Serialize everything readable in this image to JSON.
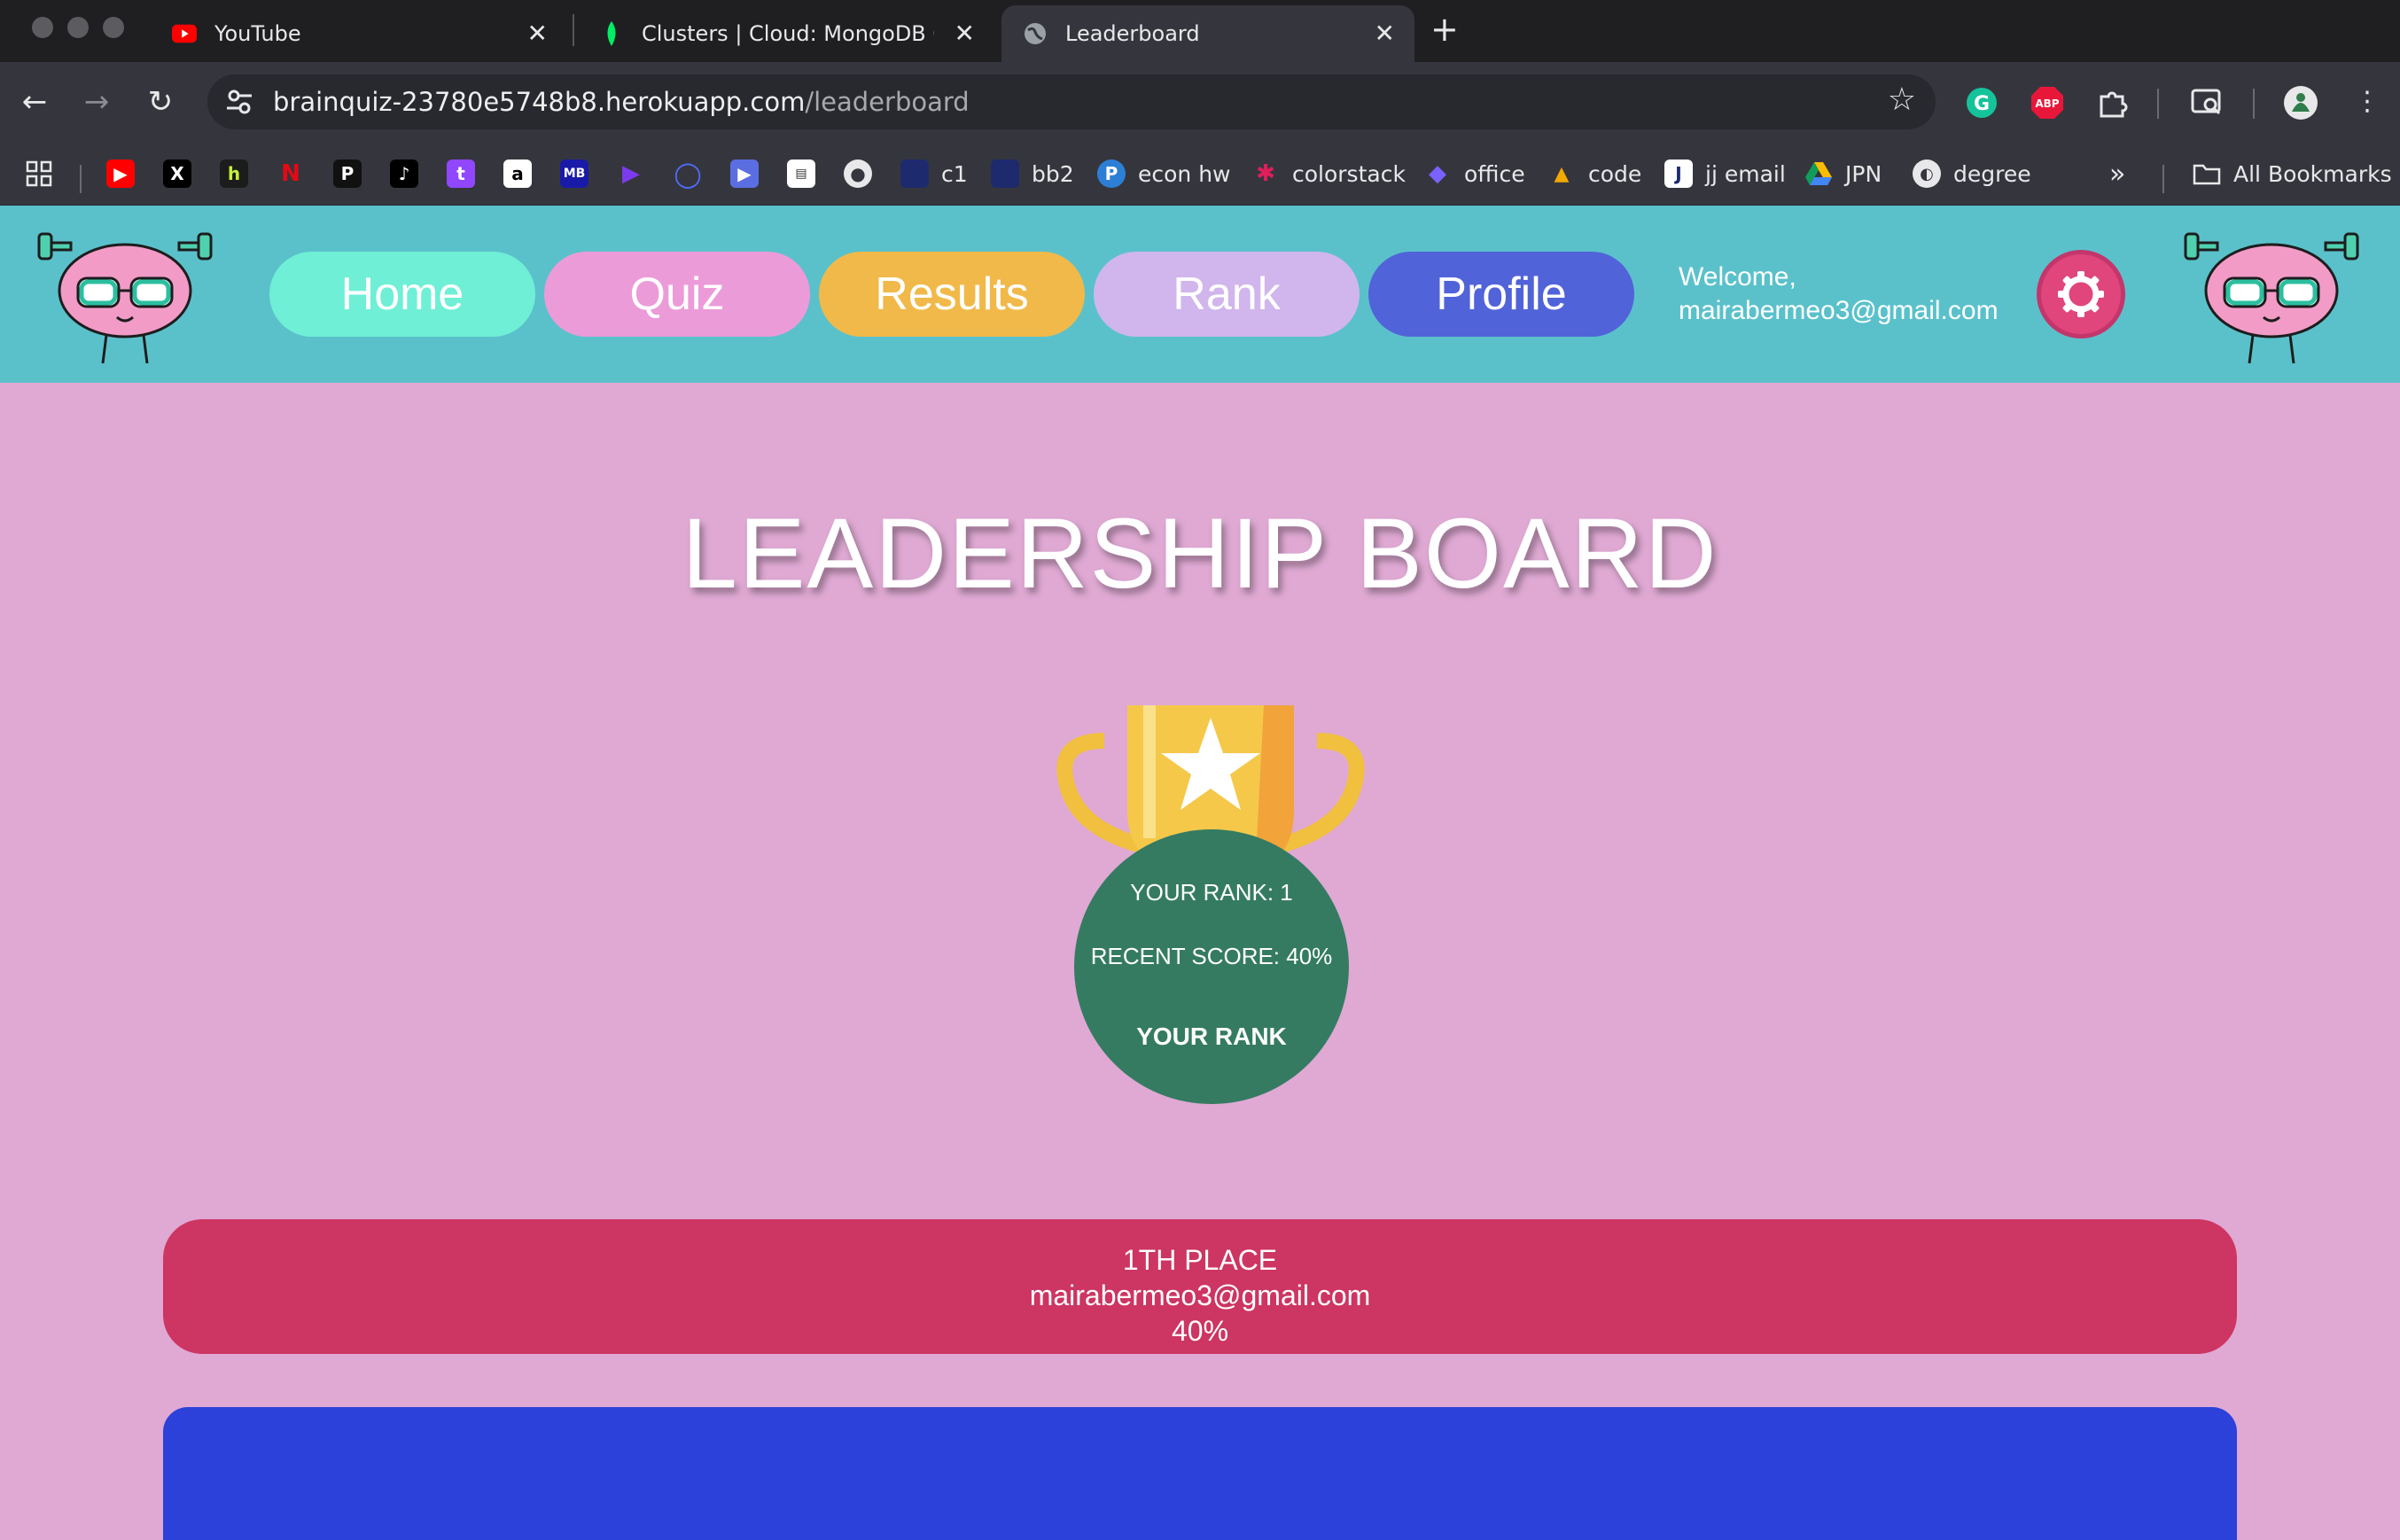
{
  "browser": {
    "tabs": [
      {
        "title": "YouTube",
        "icon": "youtube-icon",
        "active": false
      },
      {
        "title": "Clusters | Cloud: MongoDB Cl",
        "icon": "mongodb-leaf-icon",
        "active": false
      },
      {
        "title": "Leaderboard",
        "icon": "globe-icon",
        "active": true
      }
    ],
    "url_host": "brainquiz-23780e5748b8.herokuapp.com",
    "url_path": "/leaderboard",
    "bookmarks": [
      {
        "label": "c1"
      },
      {
        "label": "bb2"
      },
      {
        "label": "econ hw"
      },
      {
        "label": "colorstack"
      },
      {
        "label": "office"
      },
      {
        "label": "code"
      },
      {
        "label": "jj email"
      },
      {
        "label": "JPN"
      },
      {
        "label": "degree"
      }
    ],
    "all_bookmarks": "All Bookmarks"
  },
  "nav": {
    "home": "Home",
    "quiz": "Quiz",
    "results": "Results",
    "rank": "Rank",
    "profile": "Profile",
    "welcome_line1": "Welcome,",
    "welcome_line2": "mairabermeo3@gmail.com"
  },
  "leaderboard": {
    "title": "LEADERSHIP BOARD",
    "your_rank": "YOUR RANK: 1",
    "recent_score": "RECENT SCORE: 40%",
    "your_rank_button": "YOUR RANK",
    "entries": [
      {
        "place": "1TH PLACE",
        "email": "mairabermeo3@gmail.com",
        "score": "40%"
      }
    ]
  },
  "colors": {
    "page_bg": "#dfa9d3",
    "header_bg": "#5ac1cb",
    "home": "#6fefd6",
    "quiz": "#ec9bd9",
    "results": "#f1b949",
    "rank": "#d0b6ec",
    "profile": "#5163d9",
    "rank_circle": "#357b62",
    "first_place": "#cd3563",
    "second_card": "#2c41d9"
  }
}
